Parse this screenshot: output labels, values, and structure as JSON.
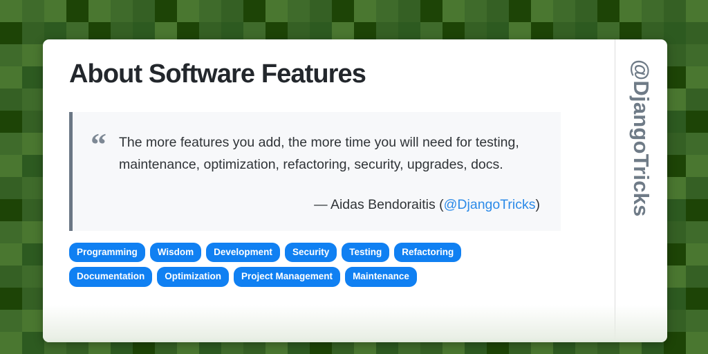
{
  "page": {
    "title": "About Software Features",
    "vertical_handle": "@DjangoTricks"
  },
  "quote": {
    "mark": "“",
    "text": "The more features you add, the more time you will need for testing, maintenance, optimization, refactoring, security, upgrades, docs.",
    "attribution_dash": "—",
    "attribution_author": "Aidas Bendoraitis",
    "attribution_open_paren": "(",
    "attribution_handle": "@DjangoTricks",
    "attribution_close_paren": ")"
  },
  "tags": [
    "Programming",
    "Wisdom",
    "Development",
    "Security",
    "Testing",
    "Refactoring",
    "Documentation",
    "Optimization",
    "Project Management",
    "Maintenance"
  ],
  "colors": {
    "tag_background": "#1080f2",
    "tag_text": "#ffffff",
    "link": "#2b8ae8",
    "title_text": "#23272c",
    "quote_background": "#f7f8fa",
    "quote_bar": "#6b7785",
    "handle_text": "#6f7b87",
    "card_background": "#ffffff",
    "background_greens": [
      "#4a7730",
      "#3f6b2b",
      "#356024",
      "#2d5a20",
      "#1d4406",
      "#14380a"
    ]
  },
  "background": {
    "tile_size": 32,
    "columns": 32,
    "rows": 16,
    "tile_shades": [
      [
        0,
        1,
        0,
        4,
        0,
        1,
        2,
        4,
        0,
        1,
        2,
        4,
        0,
        1,
        2,
        4,
        0,
        1,
        2,
        4,
        0,
        1,
        2,
        4,
        0,
        1,
        2,
        4,
        0,
        1,
        2,
        0
      ],
      [
        4,
        2,
        3,
        1,
        4,
        2,
        3,
        0,
        4,
        2,
        3,
        1,
        4,
        2,
        3,
        0,
        4,
        2,
        3,
        1,
        4,
        2,
        3,
        0,
        4,
        2,
        3,
        1,
        4,
        2,
        3,
        2
      ],
      [
        1,
        0,
        2,
        3,
        1,
        0,
        2,
        3,
        1,
        0,
        2,
        3,
        1,
        0,
        2,
        3,
        1,
        0,
        2,
        3,
        1,
        0,
        2,
        3,
        1,
        0,
        2,
        3,
        1,
        0,
        2,
        1
      ],
      [
        0,
        3,
        1,
        2,
        0,
        3,
        4,
        2,
        0,
        3,
        1,
        2,
        0,
        3,
        4,
        2,
        0,
        3,
        1,
        2,
        0,
        3,
        4,
        2,
        0,
        3,
        1,
        2,
        0,
        3,
        4,
        0
      ],
      [
        2,
        1,
        0,
        1,
        2,
        1,
        0,
        1,
        2,
        1,
        0,
        1,
        2,
        1,
        0,
        1,
        2,
        1,
        0,
        1,
        2,
        1,
        0,
        1,
        2,
        1,
        0,
        1,
        2,
        1,
        0,
        2
      ],
      [
        4,
        2,
        3,
        0,
        4,
        2,
        3,
        1,
        4,
        2,
        3,
        0,
        4,
        2,
        3,
        1,
        4,
        2,
        3,
        0,
        4,
        2,
        3,
        1,
        4,
        2,
        3,
        0,
        4,
        2,
        3,
        4
      ],
      [
        1,
        0,
        2,
        3,
        1,
        0,
        2,
        3,
        1,
        0,
        2,
        3,
        1,
        0,
        2,
        3,
        1,
        0,
        2,
        3,
        1,
        0,
        2,
        3,
        1,
        0,
        2,
        3,
        1,
        0,
        2,
        1
      ],
      [
        0,
        3,
        1,
        2,
        0,
        3,
        4,
        2,
        0,
        3,
        1,
        2,
        0,
        3,
        4,
        2,
        0,
        3,
        1,
        2,
        0,
        3,
        4,
        2,
        0,
        3,
        1,
        2,
        0,
        3,
        4,
        0
      ],
      [
        2,
        1,
        0,
        1,
        2,
        1,
        0,
        1,
        2,
        1,
        0,
        1,
        2,
        1,
        0,
        1,
        2,
        1,
        0,
        1,
        2,
        1,
        0,
        1,
        2,
        1,
        0,
        1,
        2,
        1,
        0,
        2
      ],
      [
        4,
        2,
        3,
        0,
        4,
        2,
        3,
        1,
        4,
        2,
        3,
        0,
        4,
        2,
        3,
        1,
        4,
        2,
        3,
        0,
        4,
        2,
        3,
        1,
        4,
        2,
        3,
        0,
        4,
        2,
        3,
        4
      ],
      [
        1,
        0,
        2,
        3,
        1,
        0,
        2,
        3,
        1,
        0,
        2,
        3,
        1,
        0,
        2,
        3,
        1,
        0,
        2,
        3,
        1,
        0,
        2,
        3,
        1,
        0,
        2,
        3,
        1,
        0,
        2,
        1
      ],
      [
        0,
        3,
        1,
        2,
        0,
        3,
        4,
        2,
        0,
        3,
        1,
        2,
        0,
        3,
        4,
        2,
        0,
        3,
        1,
        2,
        0,
        3,
        4,
        2,
        0,
        3,
        1,
        2,
        0,
        3,
        4,
        0
      ],
      [
        2,
        1,
        0,
        1,
        2,
        1,
        0,
        1,
        2,
        1,
        0,
        1,
        2,
        1,
        0,
        1,
        2,
        1,
        0,
        1,
        2,
        1,
        0,
        1,
        2,
        1,
        0,
        1,
        2,
        1,
        0,
        2
      ],
      [
        4,
        2,
        3,
        0,
        4,
        2,
        3,
        1,
        4,
        2,
        3,
        0,
        4,
        2,
        3,
        1,
        4,
        2,
        3,
        0,
        4,
        2,
        3,
        1,
        4,
        2,
        3,
        0,
        4,
        2,
        3,
        4
      ],
      [
        1,
        0,
        2,
        3,
        1,
        0,
        2,
        3,
        1,
        0,
        2,
        3,
        1,
        0,
        2,
        3,
        1,
        0,
        2,
        3,
        1,
        0,
        2,
        3,
        1,
        0,
        2,
        3,
        1,
        0,
        2,
        1
      ],
      [
        0,
        3,
        1,
        2,
        0,
        3,
        4,
        2,
        0,
        3,
        1,
        2,
        0,
        3,
        4,
        2,
        0,
        3,
        1,
        2,
        0,
        3,
        4,
        2,
        0,
        3,
        1,
        2,
        0,
        3,
        4,
        0
      ]
    ]
  }
}
